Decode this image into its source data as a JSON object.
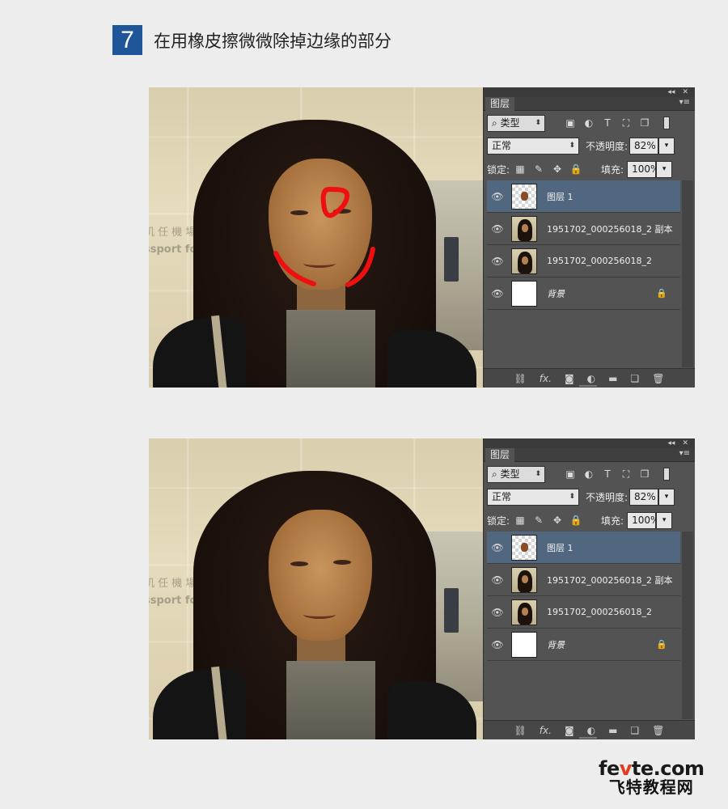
{
  "step": {
    "number": "7",
    "text": "在用橡皮擦微微除掉边缘的部分"
  },
  "photo": {
    "sign_cn": "机 任 機 場",
    "sign_en": "ssport for y"
  },
  "panel": {
    "tab": "图层",
    "filter_label": "类型",
    "blend_mode": "正常",
    "opacity_label": "不透明度:",
    "opacity_value": "82%",
    "lock_label": "锁定:",
    "fill_label": "填充:",
    "fill_value": "100%",
    "layers": [
      {
        "name": "图层 1",
        "selected": true
      },
      {
        "name": "1951702_000256018_2 副本"
      },
      {
        "name": "1951702_000256018_2"
      },
      {
        "name": "背景",
        "locked": true
      }
    ],
    "bottom_icons": [
      "link-icon",
      "fx-icon",
      "mask-icon",
      "adjustment-icon",
      "folder-icon",
      "new-layer-icon",
      "trash-icon"
    ]
  },
  "watermark": {
    "line1_a": "fe",
    "line1_v": "v",
    "line1_b": "te.com",
    "line2": "飞特教程网"
  },
  "colors": {
    "step_bg": "#1f5599",
    "selected_layer": "#51667f",
    "panel_bg": "#535353",
    "marker_red": "#ee1010"
  }
}
